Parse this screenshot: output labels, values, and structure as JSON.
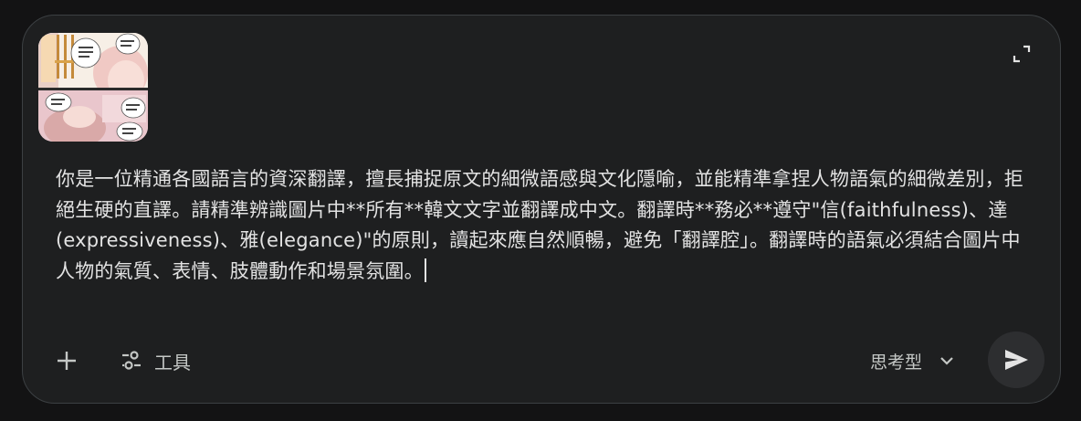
{
  "attachment": {
    "icon": "manga-page-thumbnail"
  },
  "prompt": {
    "text": "你是一位精通各國語言的資深翻譯，擅長捕捉原文的細微語感與文化隱喻，並能精準拿捏人物語氣的細微差別，拒絕生硬的直譯。請精準辨識圖片中**所有**韓文文字並翻譯成中文。翻譯時**務必**遵守\"信(faithfulness)、達(expressiveness)、雅(elegance)\"的原則，讀起來應自然順暢，避免「翻譯腔」。翻譯時的語氣必須結合圖片中人物的氣質、表情、肢體動作和場景氛圍。"
  },
  "toolbar": {
    "tools_label": "工具",
    "mode_label": "思考型"
  },
  "icons": {
    "expand": "expand-icon",
    "add": "plus-icon",
    "tools": "tune-icon",
    "mode": "chevron-down-icon",
    "send": "send-icon"
  },
  "colors": {
    "background": "#131314",
    "surface": "#1e1f20",
    "text": "#e3e3e3",
    "muted": "#c4c7c5",
    "send_bg": "#2d2e30"
  }
}
